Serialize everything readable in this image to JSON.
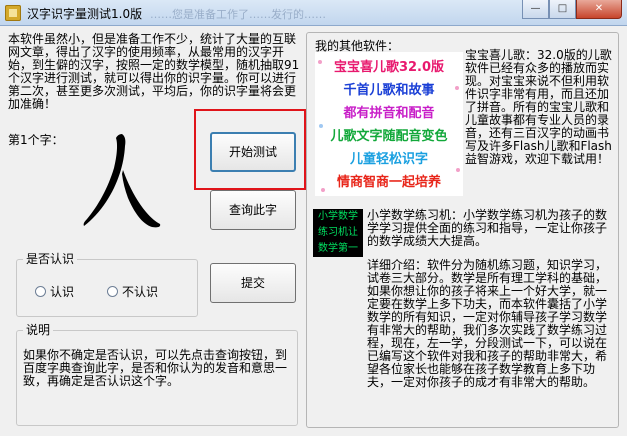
{
  "window": {
    "title": "汉字识字量测试1.0版",
    "ghost_title": "……您是准备工作了……发行的……",
    "minimize": "—",
    "maximize": "□",
    "close": "✕"
  },
  "intro_text": "本软件虽然小，但是准备工作不少，统计了大量的互联网文章，得出了汉字的使用频率，从最常用的汉字开始，到生僻的汉字，按照一定的数学模型，随机抽取91个汉字进行测试，就可以得出你的识字量。你可以进行第二次，甚至更多次测试，平均后，你的识字量将会更加准确！",
  "char_label": "第1个字：",
  "current_char": "人",
  "buttons": {
    "start": "开始测试",
    "query": "查询此字",
    "submit": "提交"
  },
  "recognize_group": {
    "title": "是否认识",
    "yes": "认识",
    "no": "不认识"
  },
  "note_group": {
    "title": "说明",
    "text": "如果你不确定是否认识，可以先点击查询按钮，到百度字典查询此字，是否和你认为的发音和意思一致，再确定是否认识这个字。"
  },
  "other_software": {
    "label": "我的其他软件：",
    "ad_lines": [
      {
        "text": "宝宝喜儿歌32.0版",
        "color": "#e8196e"
      },
      {
        "text": "千首儿歌和故事",
        "color": "#1a3fd6"
      },
      {
        "text": "都有拼音和配音",
        "color": "#c81fc8"
      },
      {
        "text": "儿歌文字随配音变色",
        "color": "#12a83a"
      },
      {
        "text": "儿童轻松识字",
        "color": "#1aa0e0"
      },
      {
        "text": "情商智商一起培养",
        "color": "#e8261a"
      }
    ],
    "ad_description": "宝宝喜儿歌：32.0版的儿歌软件已经有众多的播放而实现。对宝宝来说不但利用软件识字非常有用，而且还加了拼音。所有的宝宝儿歌和儿童故事都有专业人员的录音，还有三百汉字的动画书写及许多Flash儿歌和Flash益智游戏，欢迎下载试用！",
    "math_badge": [
      "小学数学",
      "练习机让",
      "数学第一"
    ],
    "math_title_desc": "小学数学练习机：小学数学练习机为孩子的数学学习提供全面的练习和指导，一定让你孩子的数学成绩大大提高。",
    "detail_desc": "详细介绍：软件分为随机练习题，知识学习，试卷三大部分。数学是所有理工学科的基础，如果你想让你的孩子将来上一个好大学，就一定要在数学上多下功夫，而本软件囊括了小学数学的所有知识，一定对你辅导孩子学习数学有非常大的帮助，我们多次实践了数学练习过程，现在，左一学，分段测试一下，可以说在已编写这个软件对我和孩子的帮助非常大，希望各位家长也能够在孩子数学教育上多下功夫，一定对你孩子的成才有非常大的帮助。"
  },
  "colors": {
    "highlight_frame": "#e0141a",
    "start_button_border": "#3c7fb1",
    "badge_bg": "#000000",
    "badge_text": "#00e060"
  }
}
